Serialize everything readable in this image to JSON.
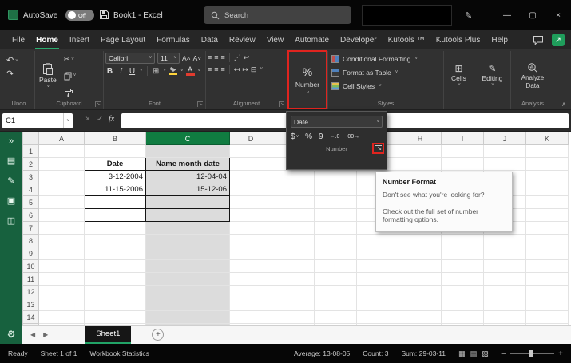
{
  "titlebar": {
    "autosave_label": "AutoSave",
    "autosave_state": "Off",
    "title": "Book1 - Excel",
    "search_placeholder": "Search",
    "window_minimize": "—",
    "window_maximize": "▢",
    "window_close": "×"
  },
  "menu": {
    "active_tab": "Home",
    "tabs": [
      "File",
      "Home",
      "Insert",
      "Page Layout",
      "Formulas",
      "Data",
      "Review",
      "View",
      "Automate",
      "Developer",
      "Kutools ™",
      "Kutools Plus",
      "Help"
    ]
  },
  "ribbon": {
    "undo": {
      "label": "Undo"
    },
    "clipboard": {
      "label": "Clipboard",
      "paste": "Paste"
    },
    "font": {
      "label": "Font",
      "font_name": "Calibri",
      "font_size": "11",
      "bold": "B",
      "italic": "I",
      "underline": "U"
    },
    "alignment": {
      "label": "Alignment"
    },
    "number": {
      "button": "Number",
      "percent": "%"
    },
    "styles": {
      "label": "Styles",
      "conditional_formatting": "Conditional Formatting",
      "format_as_table": "Format as Table",
      "cell_styles": "Cell Styles"
    },
    "cells": {
      "button": "Cells"
    },
    "editing": {
      "button": "Editing"
    },
    "analysis": {
      "label": "Analysis",
      "button": "Analyze Data"
    }
  },
  "number_panel": {
    "selected_format": "Date",
    "group_label": "Number",
    "currency": "$",
    "percent": "%",
    "comma": "9"
  },
  "tooltip": {
    "title": "Number Format",
    "line1": "Don't see what you're looking for?",
    "line2": "Check out the full set of number formatting options."
  },
  "formula_bar": {
    "name_box": "C1",
    "fx": "fx",
    "value": ""
  },
  "grid": {
    "columns": [
      "A",
      "B",
      "C",
      "D",
      "E",
      "F",
      "G",
      "H",
      "I",
      "J",
      "K"
    ],
    "num_rows": 15,
    "selected_column": "C",
    "bordered_cols": [
      "B",
      "C"
    ],
    "bordered_row_start": 2,
    "bordered_row_end": 6,
    "cells": [
      {
        "ref": "B2",
        "text": "Date",
        "bold": true,
        "align": "center"
      },
      {
        "ref": "C2",
        "text": "Name month date",
        "bold": true,
        "align": "center"
      },
      {
        "ref": "B3",
        "text": "3-12-2004",
        "align": "right"
      },
      {
        "ref": "C3",
        "text": "12-04-04",
        "align": "right"
      },
      {
        "ref": "B4",
        "text": "11-15-2006",
        "align": "right"
      },
      {
        "ref": "C4",
        "text": "15-12-06",
        "align": "right"
      }
    ]
  },
  "sidebar": {
    "icons": [
      {
        "name": "sidebar-expand-icon",
        "glyph": "»"
      },
      {
        "name": "sidebar-sheet-icon",
        "glyph": "▤"
      },
      {
        "name": "sidebar-edit-icon",
        "glyph": "✎"
      },
      {
        "name": "sidebar-print-icon",
        "glyph": "▣"
      },
      {
        "name": "sidebar-chart-icon",
        "glyph": "◫"
      }
    ],
    "gear_glyph": "⚙"
  },
  "sheet_tabs": {
    "active": "Sheet1",
    "add_label": "+"
  },
  "status_bar": {
    "ready": "Ready",
    "sheet_info": "Sheet 1 of 1",
    "workbook_statistics": "Workbook Statistics",
    "average": "Average: 13-08-05",
    "count": "Count: 3",
    "sum": "Sum: 29-03-11"
  },
  "colors": {
    "excel_green": "#107c41",
    "accent_green": "#21a366",
    "highlight_red": "#e0241f",
    "selected_fill": "#dcdcdc"
  }
}
